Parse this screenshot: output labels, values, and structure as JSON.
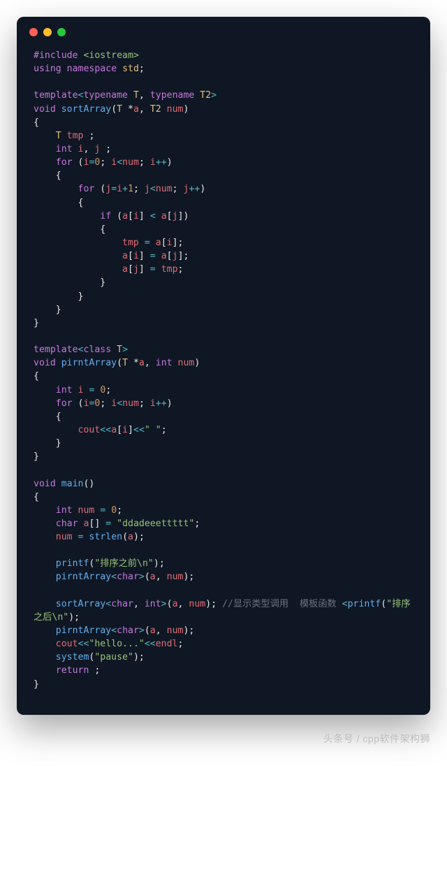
{
  "traffic_lights": [
    "red",
    "yellow",
    "green"
  ],
  "code_tokens": [
    [
      [
        "c-pp",
        "#include"
      ],
      [
        "c-id",
        " "
      ],
      [
        "c-ang",
        "<iostream>"
      ]
    ],
    [
      [
        "c-kw",
        "using"
      ],
      [
        "c-id",
        " "
      ],
      [
        "c-kw",
        "namespace"
      ],
      [
        "c-id",
        " "
      ],
      [
        "c-type",
        "std"
      ],
      [
        "c-id",
        ";"
      ]
    ],
    [],
    [
      [
        "c-kw",
        "template"
      ],
      [
        "c-op",
        "<"
      ],
      [
        "c-kw",
        "typename"
      ],
      [
        "c-id",
        " "
      ],
      [
        "c-type",
        "T"
      ],
      [
        "c-id",
        ", "
      ],
      [
        "c-kw",
        "typename"
      ],
      [
        "c-id",
        " "
      ],
      [
        "c-type",
        "T2"
      ],
      [
        "c-op",
        ">"
      ]
    ],
    [
      [
        "c-kw",
        "void"
      ],
      [
        "c-id",
        " "
      ],
      [
        "c-fn",
        "sortArray"
      ],
      [
        "c-id",
        "("
      ],
      [
        "c-type",
        "T"
      ],
      [
        "c-id",
        " *"
      ],
      [
        "c-var",
        "a"
      ],
      [
        "c-id",
        ", "
      ],
      [
        "c-type",
        "T2"
      ],
      [
        "c-id",
        " "
      ],
      [
        "c-var",
        "num"
      ],
      [
        "c-id",
        ")"
      ]
    ],
    [
      [
        "c-id",
        "{"
      ]
    ],
    [
      [
        "c-id",
        "    "
      ],
      [
        "c-type",
        "T"
      ],
      [
        "c-id",
        " "
      ],
      [
        "c-var",
        "tmp"
      ],
      [
        "c-id",
        " ;"
      ]
    ],
    [
      [
        "c-id",
        "    "
      ],
      [
        "c-kw",
        "int"
      ],
      [
        "c-id",
        " "
      ],
      [
        "c-var",
        "i"
      ],
      [
        "c-id",
        ", "
      ],
      [
        "c-var",
        "j"
      ],
      [
        "c-id",
        " ;"
      ]
    ],
    [
      [
        "c-id",
        "    "
      ],
      [
        "c-kw",
        "for"
      ],
      [
        "c-id",
        " ("
      ],
      [
        "c-var",
        "i"
      ],
      [
        "c-op",
        "="
      ],
      [
        "c-num",
        "0"
      ],
      [
        "c-id",
        "; "
      ],
      [
        "c-var",
        "i"
      ],
      [
        "c-op",
        "<"
      ],
      [
        "c-var",
        "num"
      ],
      [
        "c-id",
        "; "
      ],
      [
        "c-var",
        "i"
      ],
      [
        "c-op",
        "++"
      ],
      [
        "c-id",
        ")"
      ]
    ],
    [
      [
        "c-id",
        "    {"
      ]
    ],
    [
      [
        "c-id",
        "        "
      ],
      [
        "c-kw",
        "for"
      ],
      [
        "c-id",
        " ("
      ],
      [
        "c-var",
        "j"
      ],
      [
        "c-op",
        "="
      ],
      [
        "c-var",
        "i"
      ],
      [
        "c-op",
        "+"
      ],
      [
        "c-num",
        "1"
      ],
      [
        "c-id",
        "; "
      ],
      [
        "c-var",
        "j"
      ],
      [
        "c-op",
        "<"
      ],
      [
        "c-var",
        "num"
      ],
      [
        "c-id",
        "; "
      ],
      [
        "c-var",
        "j"
      ],
      [
        "c-op",
        "++"
      ],
      [
        "c-id",
        ")"
      ]
    ],
    [
      [
        "c-id",
        "        {"
      ]
    ],
    [
      [
        "c-id",
        "            "
      ],
      [
        "c-kw",
        "if"
      ],
      [
        "c-id",
        " ("
      ],
      [
        "c-var",
        "a"
      ],
      [
        "c-id",
        "["
      ],
      [
        "c-var",
        "i"
      ],
      [
        "c-id",
        "] "
      ],
      [
        "c-op",
        "<"
      ],
      [
        "c-id",
        " "
      ],
      [
        "c-var",
        "a"
      ],
      [
        "c-id",
        "["
      ],
      [
        "c-var",
        "j"
      ],
      [
        "c-id",
        "])"
      ]
    ],
    [
      [
        "c-id",
        "            {"
      ]
    ],
    [
      [
        "c-id",
        "                "
      ],
      [
        "c-var",
        "tmp"
      ],
      [
        "c-id",
        " "
      ],
      [
        "c-op",
        "="
      ],
      [
        "c-id",
        " "
      ],
      [
        "c-var",
        "a"
      ],
      [
        "c-id",
        "["
      ],
      [
        "c-var",
        "i"
      ],
      [
        "c-id",
        "];"
      ]
    ],
    [
      [
        "c-id",
        "                "
      ],
      [
        "c-var",
        "a"
      ],
      [
        "c-id",
        "["
      ],
      [
        "c-var",
        "i"
      ],
      [
        "c-id",
        "] "
      ],
      [
        "c-op",
        "="
      ],
      [
        "c-id",
        " "
      ],
      [
        "c-var",
        "a"
      ],
      [
        "c-id",
        "["
      ],
      [
        "c-var",
        "j"
      ],
      [
        "c-id",
        "];"
      ]
    ],
    [
      [
        "c-id",
        "                "
      ],
      [
        "c-var",
        "a"
      ],
      [
        "c-id",
        "["
      ],
      [
        "c-var",
        "j"
      ],
      [
        "c-id",
        "] "
      ],
      [
        "c-op",
        "="
      ],
      [
        "c-id",
        " "
      ],
      [
        "c-var",
        "tmp"
      ],
      [
        "c-id",
        ";"
      ]
    ],
    [
      [
        "c-id",
        "            }"
      ]
    ],
    [
      [
        "c-id",
        "        }"
      ]
    ],
    [
      [
        "c-id",
        "    }"
      ]
    ],
    [
      [
        "c-id",
        "}"
      ]
    ],
    [],
    [
      [
        "c-kw",
        "template"
      ],
      [
        "c-op",
        "<"
      ],
      [
        "c-kw",
        "class"
      ],
      [
        "c-id",
        " "
      ],
      [
        "c-type",
        "T"
      ],
      [
        "c-op",
        ">"
      ]
    ],
    [
      [
        "c-kw",
        "void"
      ],
      [
        "c-id",
        " "
      ],
      [
        "c-fn",
        "pirntArray"
      ],
      [
        "c-id",
        "("
      ],
      [
        "c-type",
        "T"
      ],
      [
        "c-id",
        " *"
      ],
      [
        "c-var",
        "a"
      ],
      [
        "c-id",
        ", "
      ],
      [
        "c-kw",
        "int"
      ],
      [
        "c-id",
        " "
      ],
      [
        "c-var",
        "num"
      ],
      [
        "c-id",
        ")"
      ]
    ],
    [
      [
        "c-id",
        "{"
      ]
    ],
    [
      [
        "c-id",
        "    "
      ],
      [
        "c-kw",
        "int"
      ],
      [
        "c-id",
        " "
      ],
      [
        "c-var",
        "i"
      ],
      [
        "c-id",
        " "
      ],
      [
        "c-op",
        "="
      ],
      [
        "c-id",
        " "
      ],
      [
        "c-num",
        "0"
      ],
      [
        "c-id",
        ";"
      ]
    ],
    [
      [
        "c-id",
        "    "
      ],
      [
        "c-kw",
        "for"
      ],
      [
        "c-id",
        " ("
      ],
      [
        "c-var",
        "i"
      ],
      [
        "c-op",
        "="
      ],
      [
        "c-num",
        "0"
      ],
      [
        "c-id",
        "; "
      ],
      [
        "c-var",
        "i"
      ],
      [
        "c-op",
        "<"
      ],
      [
        "c-var",
        "num"
      ],
      [
        "c-id",
        "; "
      ],
      [
        "c-var",
        "i"
      ],
      [
        "c-op",
        "++"
      ],
      [
        "c-id",
        ")"
      ]
    ],
    [
      [
        "c-id",
        "    {"
      ]
    ],
    [
      [
        "c-id",
        "        "
      ],
      [
        "c-var",
        "cout"
      ],
      [
        "c-op",
        "<<"
      ],
      [
        "c-var",
        "a"
      ],
      [
        "c-id",
        "["
      ],
      [
        "c-var",
        "i"
      ],
      [
        "c-id",
        "]"
      ],
      [
        "c-op",
        "<<"
      ],
      [
        "c-str",
        "\" \""
      ],
      [
        "c-id",
        ";"
      ]
    ],
    [
      [
        "c-id",
        "    }"
      ]
    ],
    [
      [
        "c-id",
        "}"
      ]
    ],
    [],
    [
      [
        "c-kw",
        "void"
      ],
      [
        "c-id",
        " "
      ],
      [
        "c-fn",
        "main"
      ],
      [
        "c-id",
        "()"
      ]
    ],
    [
      [
        "c-id",
        "{"
      ]
    ],
    [
      [
        "c-id",
        "    "
      ],
      [
        "c-kw",
        "int"
      ],
      [
        "c-id",
        " "
      ],
      [
        "c-var",
        "num"
      ],
      [
        "c-id",
        " "
      ],
      [
        "c-op",
        "="
      ],
      [
        "c-id",
        " "
      ],
      [
        "c-num",
        "0"
      ],
      [
        "c-id",
        ";"
      ]
    ],
    [
      [
        "c-id",
        "    "
      ],
      [
        "c-kw",
        "char"
      ],
      [
        "c-id",
        " "
      ],
      [
        "c-var",
        "a"
      ],
      [
        "c-id",
        "[] "
      ],
      [
        "c-op",
        "="
      ],
      [
        "c-id",
        " "
      ],
      [
        "c-str",
        "\"ddadeeettttt\""
      ],
      [
        "c-id",
        ";"
      ]
    ],
    [
      [
        "c-id",
        "    "
      ],
      [
        "c-var",
        "num"
      ],
      [
        "c-id",
        " "
      ],
      [
        "c-op",
        "="
      ],
      [
        "c-id",
        " "
      ],
      [
        "c-fn",
        "strlen"
      ],
      [
        "c-id",
        "("
      ],
      [
        "c-var",
        "a"
      ],
      [
        "c-id",
        ");"
      ]
    ],
    [],
    [
      [
        "c-id",
        "    "
      ],
      [
        "c-fn",
        "printf"
      ],
      [
        "c-id",
        "("
      ],
      [
        "c-str",
        "\"排序之前\\n\""
      ],
      [
        "c-id",
        ");"
      ]
    ],
    [
      [
        "c-id",
        "    "
      ],
      [
        "c-fn",
        "pirntArray"
      ],
      [
        "c-op",
        "<"
      ],
      [
        "c-kw",
        "char"
      ],
      [
        "c-op",
        ">"
      ],
      [
        "c-id",
        "("
      ],
      [
        "c-var",
        "a"
      ],
      [
        "c-id",
        ", "
      ],
      [
        "c-var",
        "num"
      ],
      [
        "c-id",
        ");"
      ]
    ],
    [],
    [
      [
        "c-id",
        "    "
      ],
      [
        "c-fn",
        "sortArray"
      ],
      [
        "c-op",
        "<"
      ],
      [
        "c-kw",
        "char"
      ],
      [
        "c-id",
        ", "
      ],
      [
        "c-kw",
        "int"
      ],
      [
        "c-op",
        ">"
      ],
      [
        "c-id",
        "("
      ],
      [
        "c-var",
        "a"
      ],
      [
        "c-id",
        ", "
      ],
      [
        "c-var",
        "num"
      ],
      [
        "c-id",
        "); "
      ],
      [
        "c-cmt",
        "//显示类型调用  模板函数 "
      ],
      [
        "c-op",
        "<"
      ],
      [
        "c-fn",
        "printf"
      ],
      [
        "c-id",
        "("
      ],
      [
        "c-str",
        "\"排序之后\\n\""
      ],
      [
        "c-id",
        ");"
      ]
    ],
    [
      [
        "c-id",
        "    "
      ],
      [
        "c-fn",
        "pirntArray"
      ],
      [
        "c-op",
        "<"
      ],
      [
        "c-kw",
        "char"
      ],
      [
        "c-op",
        ">"
      ],
      [
        "c-id",
        "("
      ],
      [
        "c-var",
        "a"
      ],
      [
        "c-id",
        ", "
      ],
      [
        "c-var",
        "num"
      ],
      [
        "c-id",
        ");"
      ]
    ],
    [
      [
        "c-id",
        "    "
      ],
      [
        "c-var",
        "cout"
      ],
      [
        "c-op",
        "<<"
      ],
      [
        "c-str",
        "\"hello...\""
      ],
      [
        "c-op",
        "<<"
      ],
      [
        "c-var",
        "endl"
      ],
      [
        "c-id",
        ";"
      ]
    ],
    [
      [
        "c-id",
        "    "
      ],
      [
        "c-fn",
        "system"
      ],
      [
        "c-id",
        "("
      ],
      [
        "c-str",
        "\"pause\""
      ],
      [
        "c-id",
        ");"
      ]
    ],
    [
      [
        "c-id",
        "    "
      ],
      [
        "c-kw",
        "return"
      ],
      [
        "c-id",
        " ;"
      ]
    ],
    [
      [
        "c-id",
        "}"
      ]
    ]
  ],
  "footer_text": "头条号 / cpp软件架构狮"
}
